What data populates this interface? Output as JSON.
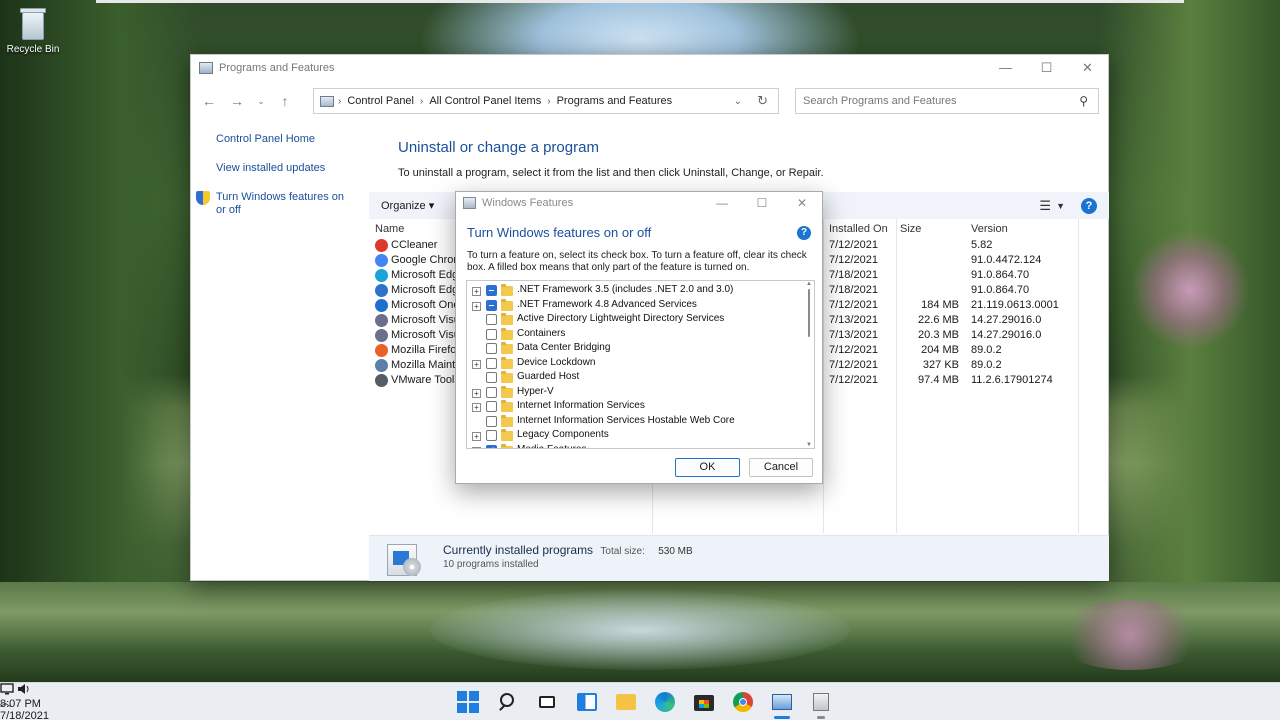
{
  "desktop": {
    "recycle_bin_label": "Recycle Bin"
  },
  "window": {
    "title": "Programs and Features",
    "controls": {
      "minimize": "—",
      "maximize": "☐",
      "close": "✕"
    },
    "nav": {
      "back": "←",
      "forward": "→",
      "recent": "⌄",
      "up": "↑"
    },
    "breadcrumb": [
      "Control Panel",
      "All Control Panel Items",
      "Programs and Features"
    ],
    "search_placeholder": "Search Programs and Features",
    "left_pane": {
      "home": "Control Panel Home",
      "view_updates": "View installed updates",
      "turn_features": "Turn Windows features on or off"
    },
    "heading": "Uninstall or change a program",
    "description": "To uninstall a program, select it from the list and then click Uninstall, Change, or Repair.",
    "toolbar": {
      "organize": "Organize ▾"
    },
    "columns": {
      "name": "Name",
      "installed_on": "Installed On",
      "size": "Size",
      "version": "Version"
    },
    "programs": [
      {
        "name": "CCleaner",
        "installed_on": "7/12/2021",
        "size": "",
        "version": "5.82",
        "icon_color": "#d93a2b"
      },
      {
        "name": "Google Chrome",
        "installed_on": "7/12/2021",
        "size": "",
        "version": "91.0.4472.124",
        "icon_color": "#4285f4"
      },
      {
        "name": "Microsoft Edge",
        "installed_on": "7/18/2021",
        "size": "",
        "version": "91.0.864.70",
        "icon_color": "#1aa3d8"
      },
      {
        "name": "Microsoft Edge Update",
        "installed_on": "7/18/2021",
        "size": "",
        "version": "91.0.864.70",
        "icon_color": "#2b74c9"
      },
      {
        "name": "Microsoft OneDrive",
        "installed_on": "7/12/2021",
        "size": "184 MB",
        "version": "21.119.0613.0001",
        "icon_color": "#1f6fd0"
      },
      {
        "name": "Microsoft Visual C++",
        "installed_on": "7/13/2021",
        "size": "22.6 MB",
        "version": "14.27.29016.0",
        "icon_color": "#6b6f8a"
      },
      {
        "name": "Microsoft Visual C++",
        "installed_on": "7/13/2021",
        "size": "20.3 MB",
        "version": "14.27.29016.0",
        "icon_color": "#6b6f8a"
      },
      {
        "name": "Mozilla Firefox",
        "installed_on": "7/12/2021",
        "size": "204 MB",
        "version": "89.0.2",
        "icon_color": "#e8622a"
      },
      {
        "name": "Mozilla Maintenance Service",
        "installed_on": "7/12/2021",
        "size": "327 KB",
        "version": "89.0.2",
        "icon_color": "#5a7fa8"
      },
      {
        "name": "VMware Tools",
        "installed_on": "7/12/2021",
        "size": "97.4 MB",
        "version": "11.2.6.17901274",
        "icon_color": "#555c63"
      }
    ],
    "status": {
      "title": "Currently installed programs",
      "total_label": "Total size:",
      "total_value": "530 MB",
      "count": "10 programs installed"
    }
  },
  "dialog": {
    "title": "Windows Features",
    "heading": "Turn Windows features on or off",
    "description": "To turn a feature on, select its check box. To turn a feature off, clear its check box. A filled box means that only part of the feature is turned on.",
    "features": [
      {
        "label": ".NET Framework 3.5 (includes .NET 2.0 and 3.0)",
        "expandable": true,
        "state": "partial"
      },
      {
        "label": ".NET Framework 4.8 Advanced Services",
        "expandable": true,
        "state": "partial"
      },
      {
        "label": "Active Directory Lightweight Directory Services",
        "expandable": false,
        "state": "off"
      },
      {
        "label": "Containers",
        "expandable": false,
        "state": "off"
      },
      {
        "label": "Data Center Bridging",
        "expandable": false,
        "state": "off"
      },
      {
        "label": "Device Lockdown",
        "expandable": true,
        "state": "off"
      },
      {
        "label": "Guarded Host",
        "expandable": false,
        "state": "off"
      },
      {
        "label": "Hyper-V",
        "expandable": true,
        "state": "off"
      },
      {
        "label": "Internet Information Services",
        "expandable": true,
        "state": "off"
      },
      {
        "label": "Internet Information Services Hostable Web Core",
        "expandable": false,
        "state": "off"
      },
      {
        "label": "Legacy Components",
        "expandable": true,
        "state": "off"
      },
      {
        "label": "Media Features",
        "expandable": true,
        "state": "checked"
      }
    ],
    "ok": "OK",
    "cancel": "Cancel"
  },
  "taskbar": {
    "time": "8:07 PM",
    "date": "7/18/2021",
    "notification_count": "6"
  }
}
